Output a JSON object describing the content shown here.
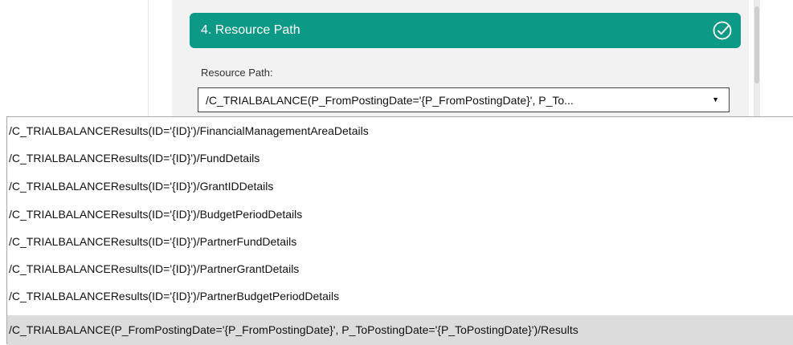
{
  "section": {
    "title": "4. Resource Path",
    "status_icon": "check-circle-icon"
  },
  "resource_path": {
    "label": "Resource Path:",
    "selected_value": "/C_TRIALBALANCE(P_FromPostingDate='{P_FromPostingDate}', P_To...",
    "arrow_icon": "dropdown-arrow-icon"
  },
  "dropdown": {
    "options": [
      "/C_TRIALBALANCEResults(ID='{ID}')/FinancialManagementAreaDetails",
      "/C_TRIALBALANCEResults(ID='{ID}')/FundDetails",
      "/C_TRIALBALANCEResults(ID='{ID}')/GrantIDDetails",
      "/C_TRIALBALANCEResults(ID='{ID}')/BudgetPeriodDetails",
      "/C_TRIALBALANCEResults(ID='{ID}')/PartnerFundDetails",
      "/C_TRIALBALANCEResults(ID='{ID}')/PartnerGrantDetails",
      "/C_TRIALBALANCEResults(ID='{ID}')/PartnerBudgetPeriodDetails",
      "/C_TRIALBALANCE(P_FromPostingDate='{P_FromPostingDate}', P_ToPostingDate='{P_ToPostingDate}')/Results"
    ],
    "highlighted_index": 7
  },
  "colors": {
    "header_bg": "#0c9a86",
    "panel_bg": "#f2f2f2",
    "highlight_bg": "#dcdcdc"
  }
}
